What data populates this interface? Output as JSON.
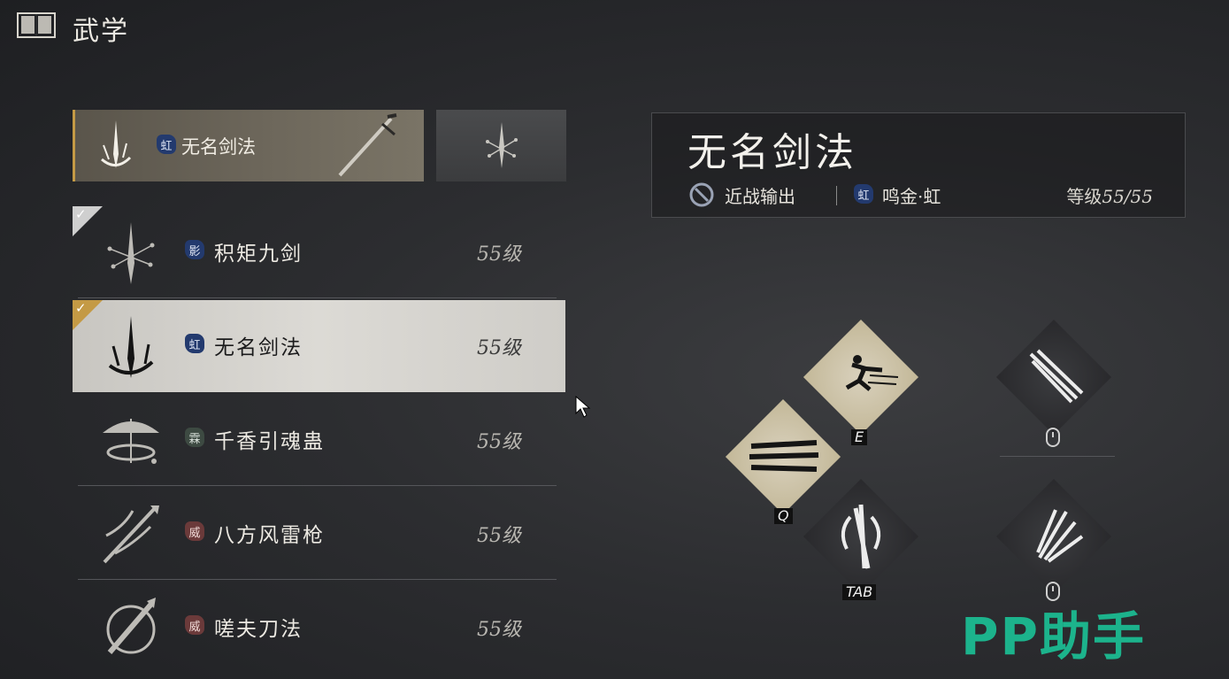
{
  "header": {
    "title": "武学",
    "icon": "book-icon"
  },
  "selected": {
    "name": "无名剑法",
    "badge": "虹"
  },
  "skills": [
    {
      "badge": "影",
      "badge_color": "blue",
      "name": "积矩九剑",
      "level": "55级",
      "checked": true,
      "active": false
    },
    {
      "badge": "虹",
      "badge_color": "blue",
      "name": "无名剑法",
      "level": "55级",
      "checked": true,
      "active": true
    },
    {
      "badge": "霖",
      "badge_color": "grey",
      "name": "千香引魂蛊",
      "level": "55级",
      "checked": false,
      "active": false
    },
    {
      "badge": "威",
      "badge_color": "red",
      "name": "八方风雷枪",
      "level": "55级",
      "checked": false,
      "active": false
    },
    {
      "badge": "威",
      "badge_color": "red",
      "name": "嗟夫刀法",
      "level": "55级",
      "checked": false,
      "active": false
    }
  ],
  "info": {
    "name": "无名剑法",
    "role": "近战输出",
    "school_badge": "虹",
    "school": "鸣金·虹",
    "level_label": "等级",
    "level_value": "55/55"
  },
  "keys": {
    "e": "E",
    "q": "Q",
    "tab": "TAB"
  },
  "watermark": "PP助手",
  "colors": {
    "accent_gold": "#c49a45",
    "badge_blue": "#233a6e",
    "watermark_green": "#1cb38c"
  }
}
